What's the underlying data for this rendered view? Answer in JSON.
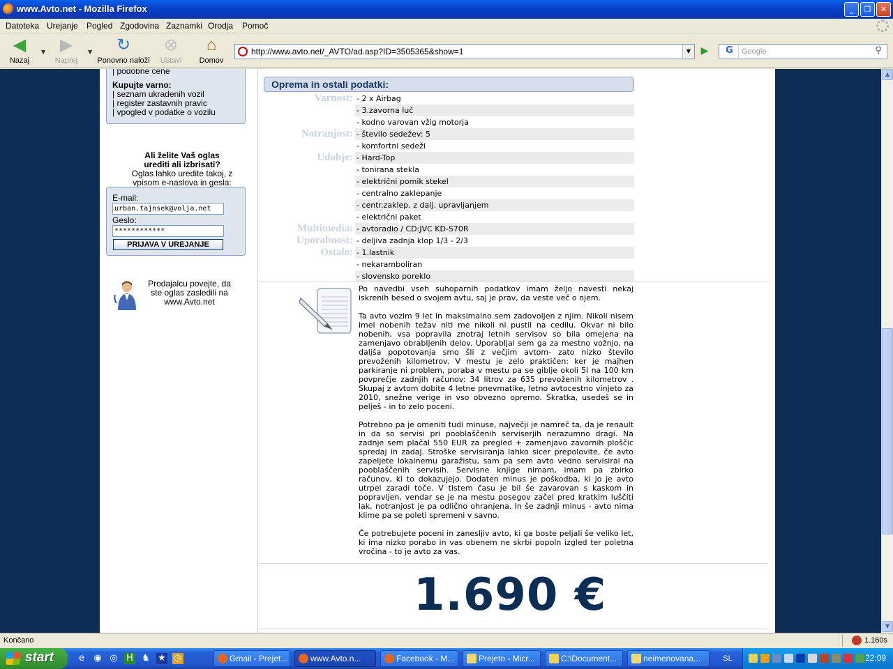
{
  "window": {
    "title": "www.Avto.net - Mozilla Firefox"
  },
  "menu": [
    "Datoteka",
    "Urejanje",
    "Pogled",
    "Zgodovina",
    "Zaznamki",
    "Orodja",
    "Pomoč"
  ],
  "toolbar": {
    "back": "Nazaj",
    "forward": "Naprej",
    "reload": "Ponovno naloži",
    "stop": "Ustavi",
    "home": "Domov",
    "url": "http://www.avto.net/_AVTO/ad.asp?ID=3505365&show=1",
    "search_placeholder": "Google"
  },
  "sidebar": {
    "top_partial": "| podobne cene",
    "safe_title": "Kupujte varno:",
    "safe_links": [
      "| seznam ukradenih vozil",
      "| register zastavnih pravic",
      "| vpogled v podatke o vozilu"
    ],
    "edit_q1": "Ali želite Vaš oglas",
    "edit_q2": "urediti ali izbrisati?",
    "edit_info1": "Oglas lahko uredite takoj, z",
    "edit_info2": "vpisom e-naslova in gesla:",
    "email_label": "E-mail:",
    "email_value": "urban.tajnsek@volja.net",
    "password_label": "Geslo:",
    "password_value": "************",
    "login_button": "PRIJAVA V UREJANJE",
    "seller_note1": "Prodajalcu povejte, da",
    "seller_note2": "ste oglas zasledili na",
    "seller_note3": "www.Avto.net"
  },
  "equipment": {
    "header": "Oprema in ostali podatki:",
    "categories": {
      "safety": "Varnost:",
      "interior": "Notranjost:",
      "comfort": "Udobje:",
      "multimedia": "Multimedia:",
      "usability": "Uporabnost:",
      "other": "Ostalo:"
    },
    "items": [
      "- 2 x Airbag",
      "- 3.zavorna luč",
      "- kodno varovan vžig motorja",
      "- število sedežev: 5",
      "- komfortni sedeži",
      "- Hard-Top",
      "- tonirana stekla",
      "- električni pomik stekel",
      "- centralno zaklepanje",
      "- centr.zaklep. z dalj. upravljanjem",
      "- električni paket",
      "- avtoradio / CD:JVC KD-S70R",
      "- deljiva zadnja klop 1/3 - 2/3",
      "- 1.lastnik",
      "- nekaramboliran",
      "- slovensko poreklo"
    ]
  },
  "description": {
    "p1": "Po navedbi vseh suhoparnih podatkov imam željo navesti nekaj iskrenih besed o svojem avtu, saj je prav, da veste več o njem.",
    "p2": "Ta avto vozim 9 let in maksimalno sem zadovoljen z njim. Nikoli nisem imel nobenih težav niti me nikoli ni pustil na cedilu. Okvar ni bilo nobenih, vsa popravila znotraj letnih servisov so bila omejena na zamenjavo obrabljenih delov. Uporabljal sem ga za mestno vožnjo, na daljša popotovanja smo šli z večjim avtom- zato nizko število prevoženih kilometrov. V mestu je zelo praktičen: ker je majhen parkiranje ni problem, poraba v mestu pa se giblje okoli 5l na 100 km povprečje zadnjih računov: 34 litrov za 635 prevoženih kilometrov . Skupaj z avtom dobite 4 letne pnevmatike, letno avtocestno vinjeto za 2010, snežne verige in vso obvezno opremo. Skratka, usedeš se in pelješ - in to zelo poceni.",
    "p3": "Potrebno pa je omeniti tudi minuse, največji je namreč ta, da je renault in da so servisi pri pooblaščenih serviserjih nerazumno dragi. Na zadnje sem plačal 550 EUR za pregled + zamenjavo zavornih ploščic spredaj in zadaj. Stroške servisiranja lahko sicer prepolovite, če avto zapeljete lokalnemu garažistu, sam pa sem avto vedno servisiral na pooblaščenih servisih. Servisne knjige nimam, imam pa zbirko računov, ki to dokazujejo. Dodaten minus je poškodba, ki jo je avto utrpel zaradi toče. V tistem času je bil še zavarovan s kaskom in popravljen, vendar se je na mestu posegov začel pred kratkim luščiti lak, notranjost je pa odlično ohranjena. In še zadnji minus - avto nima klime pa se poleti spremeni v savno.",
    "p4": "Če potrebujete poceni in zanesljiv avto, ki ga boste peljali še veliko let, ki ima nizko porabo in vas obenem ne skrbi popoln izgled ter poletna vročina - to je avto za vas."
  },
  "price": "1.690 €",
  "status": {
    "text": "Končano",
    "yslow": "1.160s"
  },
  "taskbar": {
    "start": "start",
    "buttons": [
      "Gmail - Prejet...",
      "www.Avto.n...",
      "Facebook - M...",
      "Prejeto - Micr...",
      "C:\\Document...",
      "neimenovana..."
    ],
    "active_index": 1,
    "language": "SL",
    "clock": "22:09"
  }
}
